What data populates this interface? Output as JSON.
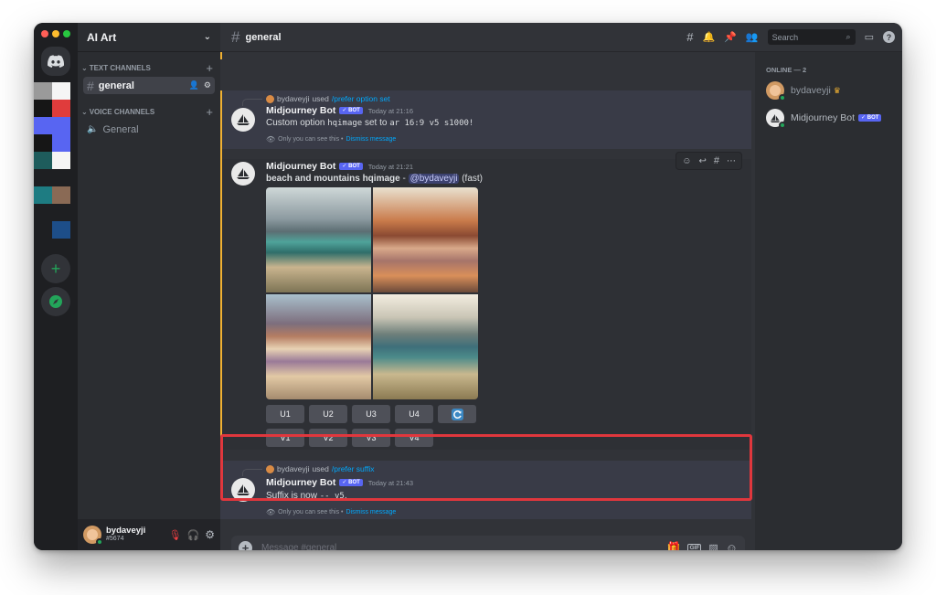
{
  "server": {
    "name": "AI Art"
  },
  "categories": {
    "text": "TEXT CHANNELS",
    "voice": "VOICE CHANNELS"
  },
  "channels": {
    "text": [
      "general"
    ],
    "voice": [
      "General"
    ]
  },
  "topbar": {
    "channel": "general",
    "search_placeholder": "Search"
  },
  "user": {
    "name": "bydaveyji",
    "discriminator": "#5674"
  },
  "messages": [
    {
      "reply_user": "bydaveyji",
      "reply_used": "used",
      "reply_cmd": "/prefer option set",
      "author": "Midjourney Bot",
      "badge": "✓ BOT",
      "time": "Today at 21:16",
      "body_pre": "Custom option ",
      "body_code1": "hqimage",
      "body_mid": " set to ",
      "body_code2": "ar 16:9 v5 s1000!",
      "note": "Only you can see this •",
      "dismiss": "Dismiss message"
    },
    {
      "author": "Midjourney Bot",
      "badge": "✓ BOT",
      "time": "Today at 21:21",
      "prompt": "beach and mountains hqimage",
      "sep": " - ",
      "mention": "@bydaveyji",
      "speed": " (fast)",
      "upscale_buttons": [
        "U1",
        "U2",
        "U3",
        "U4"
      ],
      "variation_buttons": [
        "V1",
        "V2",
        "V3",
        "V4"
      ]
    },
    {
      "reply_user": "bydaveyji",
      "reply_used": "used",
      "reply_cmd": "/prefer suffix",
      "author": "Midjourney Bot",
      "badge": "✓ BOT",
      "time": "Today at 21:43",
      "body_pre": "Suffix is now ",
      "body_code": "-- v5",
      "body_post": ".",
      "note": "Only you can see this •",
      "dismiss": "Dismiss message"
    }
  ],
  "composer": {
    "placeholder": "Message #general"
  },
  "members": {
    "header": "ONLINE — 2",
    "list": [
      {
        "name": "bydaveyji",
        "crown": "♛"
      },
      {
        "name": "Midjourney Bot",
        "badge": "✓ BOT"
      }
    ]
  },
  "colors": {
    "accent": "#5865f2",
    "highlight": "#e0373d",
    "link": "#00a8fc",
    "online": "#23a55a"
  }
}
